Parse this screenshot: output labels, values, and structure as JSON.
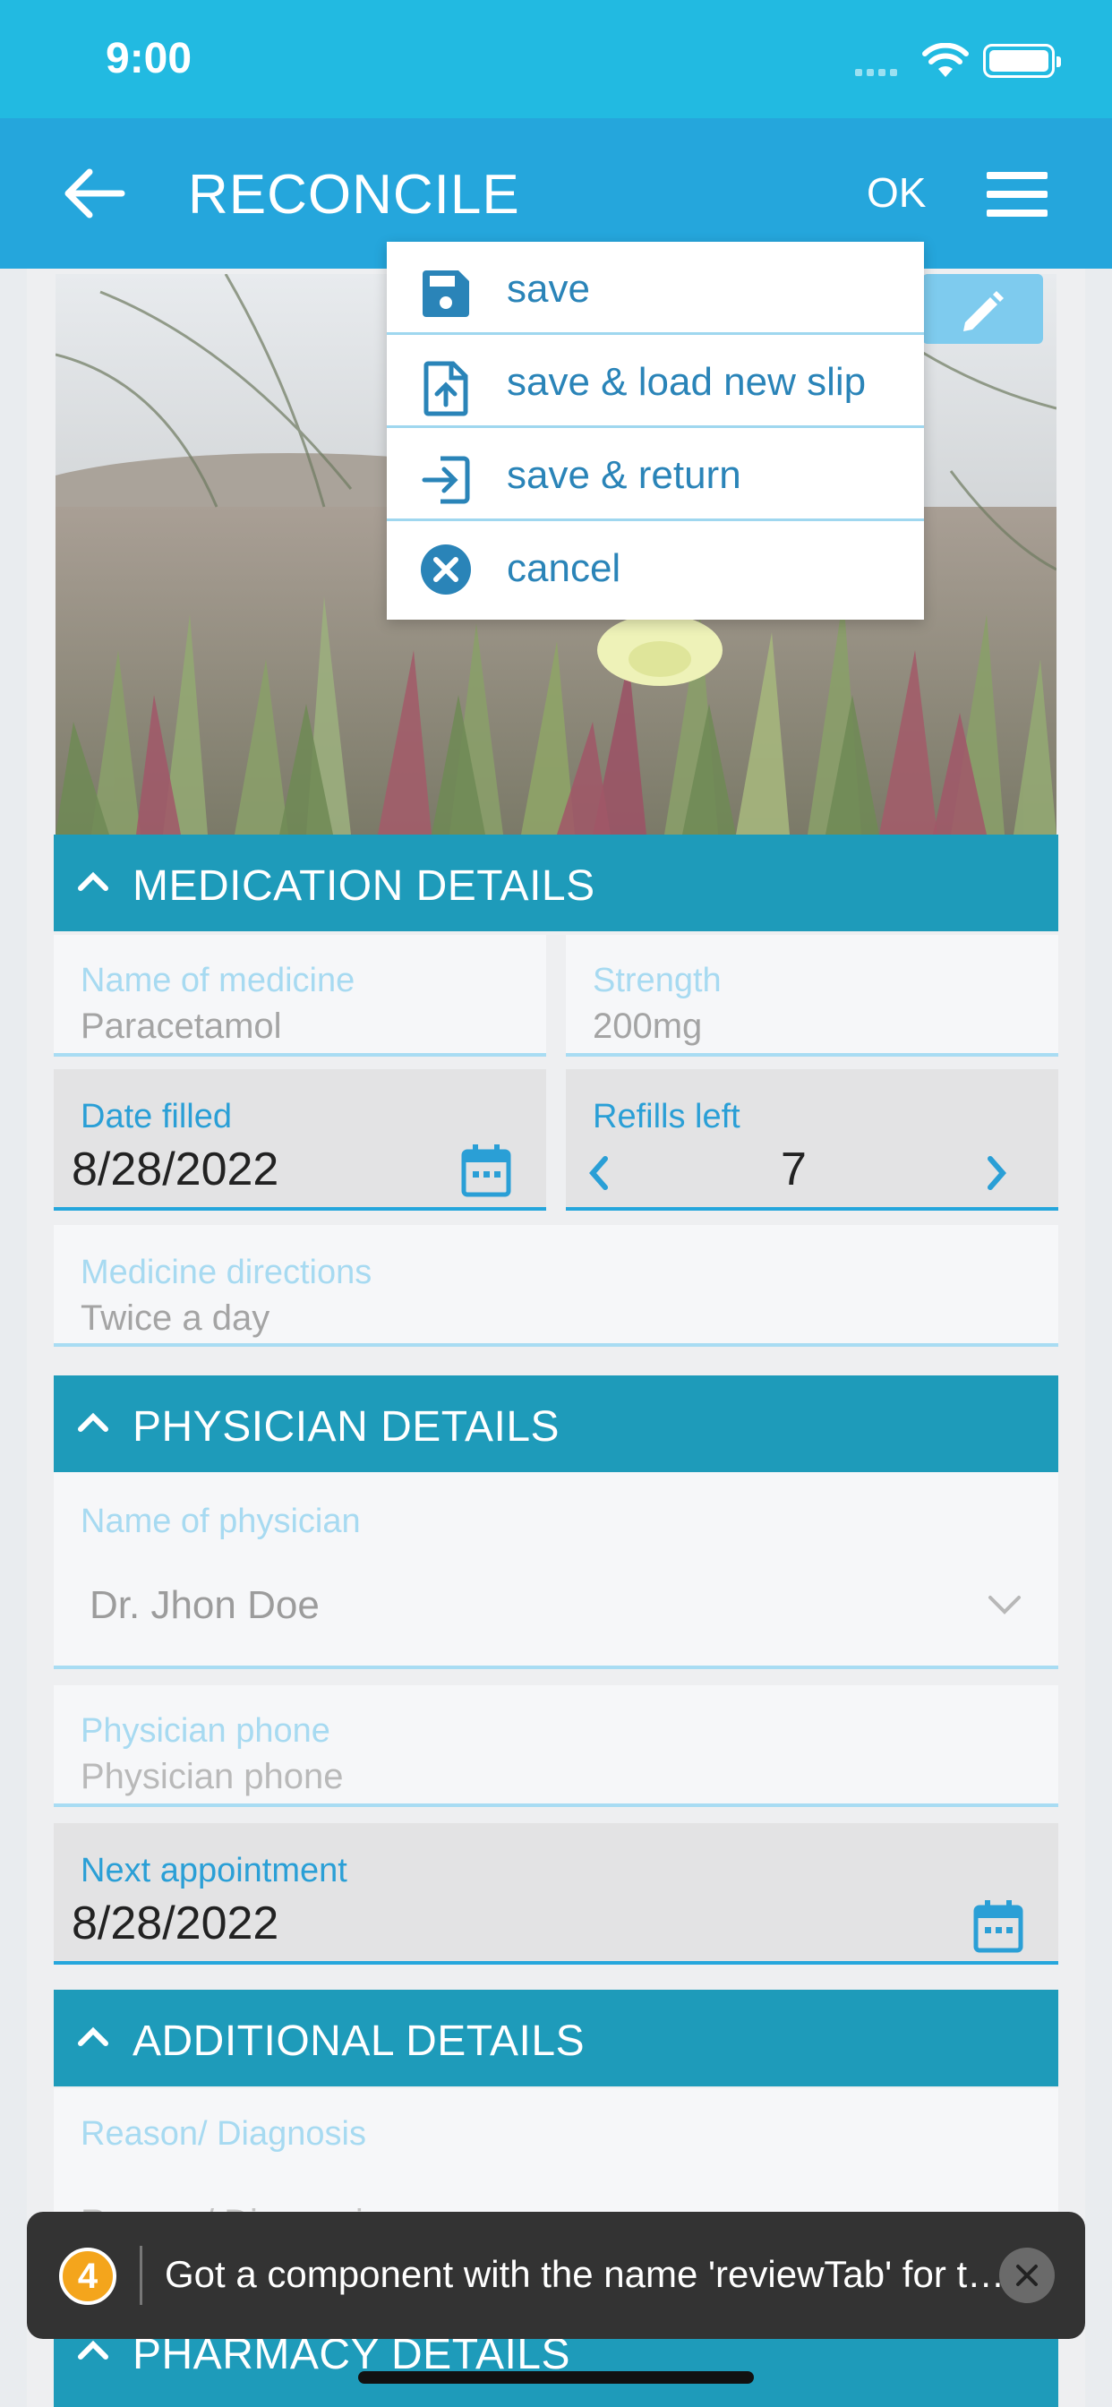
{
  "status_bar": {
    "time": "9:00"
  },
  "app_bar": {
    "title": "RECONCILE",
    "ok_label": "OK"
  },
  "dropdown": {
    "items": [
      {
        "label": "save",
        "icon": "floppy-disk-icon"
      },
      {
        "label": "save & load new slip",
        "icon": "file-upload-icon"
      },
      {
        "label": "save & return",
        "icon": "sign-in-icon"
      },
      {
        "label": "cancel",
        "icon": "close-circle-icon"
      }
    ]
  },
  "sections": {
    "medication": {
      "title": "MEDICATION DETAILS",
      "name_label": "Name of medicine",
      "name_value": "Paracetamol",
      "strength_label": "Strength",
      "strength_value": "200mg",
      "date_filled_label": "Date filled",
      "date_filled_value": "8/28/2022",
      "refills_label": "Refills left",
      "refills_value": "7",
      "directions_label": "Medicine directions",
      "directions_value": "Twice a day"
    },
    "physician": {
      "title": "PHYSICIAN DETAILS",
      "name_label": "Name of physician",
      "name_value": "Dr. Jhon Doe",
      "phone_label": "Physician phone",
      "phone_placeholder": "Physician phone",
      "next_appt_label": "Next appointment",
      "next_appt_value": "8/28/2022"
    },
    "additional": {
      "title": "ADDITIONAL DETAILS",
      "reason_label": "Reason/ Diagnosis",
      "reason_placeholder": "Reason/ Diagnosis"
    },
    "pharmacy": {
      "title": "PHARMACY DETAILS"
    }
  },
  "toast": {
    "count": "4",
    "message": "Got a component with the name 'reviewTab' for the screen name"
  },
  "colors": {
    "status_bar": "#22bae1",
    "app_bar": "#25a6dc",
    "section_header": "#1e9bba",
    "toast_badge": "#f4a51c"
  }
}
